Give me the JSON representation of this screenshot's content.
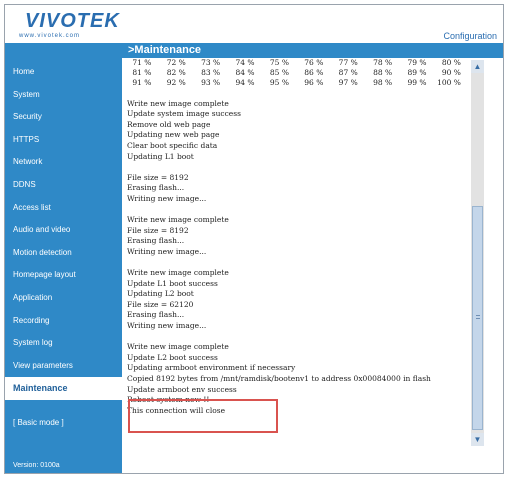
{
  "brand": {
    "logo": "VIVOTEK",
    "logo_sub": "www.vivotek.com"
  },
  "header": {
    "configuration_link": "Configuration"
  },
  "page": {
    "title": ">Maintenance"
  },
  "sidebar": {
    "items": [
      {
        "label": "Home"
      },
      {
        "label": "System"
      },
      {
        "label": "Security"
      },
      {
        "label": "HTTPS"
      },
      {
        "label": "Network"
      },
      {
        "label": "DDNS"
      },
      {
        "label": "Access list"
      },
      {
        "label": "Audio and video"
      },
      {
        "label": "Motion detection"
      },
      {
        "label": "Homepage layout"
      },
      {
        "label": "Application"
      },
      {
        "label": "Recording"
      },
      {
        "label": "System log"
      },
      {
        "label": "View parameters"
      },
      {
        "label": "Maintenance"
      }
    ],
    "basic_mode": "[ Basic mode ]",
    "version": "Version: 0100a"
  },
  "progress_rows": [
    [
      "71 %",
      "72 %",
      "73 %",
      "74 %",
      "75 %",
      "76 %",
      "77 %",
      "78 %",
      "79 %",
      "80 %"
    ],
    [
      "81 %",
      "82 %",
      "83 %",
      "84 %",
      "85 %",
      "86 %",
      "87 %",
      "88 %",
      "89 %",
      "90 %"
    ],
    [
      "91 %",
      "92 %",
      "93 %",
      "94 %",
      "95 %",
      "96 %",
      "97 %",
      "98 %",
      "99 %",
      "100 %"
    ]
  ],
  "log": {
    "l1": "Write new image complete",
    "l2": "Update system image success",
    "l3": "Remove old web page",
    "l4": "Updating new web page",
    "l5": "Clear boot specific data",
    "l6": "Updating L1 boot",
    "l7": "File size = 8192",
    "l8": "Erasing flash...",
    "l9": "Writing new image...",
    "l10": "Write new image complete",
    "l11": "File size = 8192",
    "l12": "Erasing flash...",
    "l13": "Writing new image...",
    "l14": "Write new image complete",
    "l15": "Update L1 boot success",
    "l16": "Updating L2 boot",
    "l17": "File size = 62120",
    "l18": "Erasing flash...",
    "l19": "Writing new image...",
    "l20": "Write new image complete",
    "l21": "Update L2 boot success",
    "l22": "Updating armboot environment if necessary",
    "l23": "Copied 8192 bytes from /mnt/ramdisk/bootenv1 to address 0x00084000 in flash",
    "l24": "Update armboot env success",
    "l25": "Reboot system now !!",
    "l26": "This connection will close"
  },
  "scrollbar": {
    "up_icon": "▲",
    "down_icon": "▼"
  }
}
